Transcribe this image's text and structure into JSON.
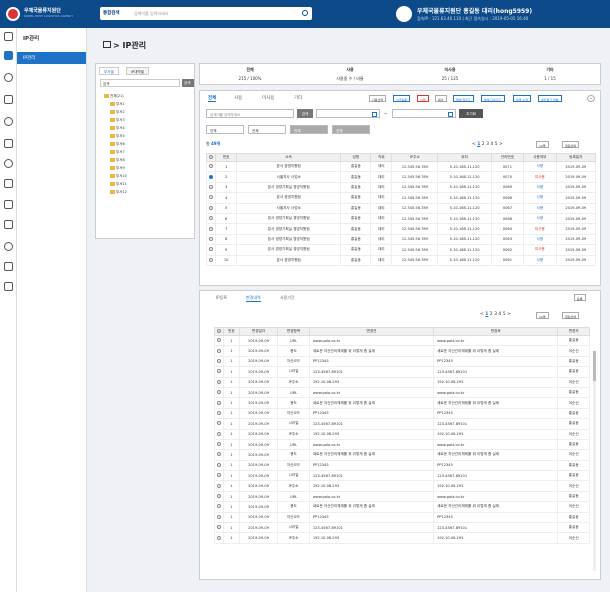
{
  "header": {
    "org_name": "우체국물류지원단",
    "org_sub": "KOREA POST LOGISTICS AGENCY",
    "search_scope": "통합검색",
    "search_placeholder": "검색어를 입력하세요",
    "user_name": "우체국물류지원단 홍길동 대리(hong5959)",
    "access_info": "접속IP : 121.63.40.110 | 최근 접속일시 : 2019-05-05 16:40"
  },
  "menu": {
    "title": "IP관리",
    "items": [
      {
        "label": "IP관리"
      }
    ]
  },
  "page": {
    "title": "IP관리"
  },
  "tree": {
    "tabs": [
      "부서별",
      "IP대역별"
    ],
    "search_label": "검색",
    "search_btn": "검색",
    "root": "전체(21)",
    "nodes": [
      "부서1",
      "부서2",
      "부서3",
      "부서4",
      "부서5",
      "부서6",
      "부서7",
      "부서8",
      "부서9",
      "부서10",
      "부서11",
      "부서12"
    ]
  },
  "stats": {
    "headers": [
      "전체",
      "사용",
      "미사용",
      "기타"
    ],
    "values": [
      "215 / 100%",
      "사용중 수 / 비율",
      "25 / 125",
      "1 / 15"
    ]
  },
  "list": {
    "tabs": [
      "전체",
      "사용",
      "미사용",
      "기타"
    ],
    "toolbar": [
      "사용선택",
      "선급등록",
      "삭제",
      "복사",
      "엑셀 업로드",
      "엑셀 다운로드",
      "일괄 수정",
      "네트워크 현황"
    ],
    "search_placeholder": "검색어를 입력하세요",
    "search_btn": "검색",
    "date_sep": "~",
    "reset_btn": "초기화",
    "filters": [
      "전체",
      "전체",
      "전체",
      "전체"
    ],
    "count_label": "총",
    "count_value": "49개",
    "pages": [
      "<",
      "1",
      "2",
      "3",
      "4",
      "5",
      ">"
    ],
    "page_size": "10줄",
    "pick_btn": "컬럼선택",
    "columns": [
      "번호",
      "소속",
      "성명",
      "직위",
      "IP주소",
      "위치",
      "관리번호",
      "사용여부",
      "등록일자"
    ],
    "rows": [
      {
        "no": "1",
        "org": "본사 경영지원팀",
        "name": "홍길동",
        "pos": "대리",
        "ip": "12.345.56.789",
        "loc": "5-10.168.11.120",
        "mgmt": "0071",
        "use": "사용",
        "date": "2019-09-09",
        "checked": false
      },
      {
        "no": "2",
        "org": "서울지사 사업소",
        "name": "홍길동",
        "pos": "대리",
        "ip": "12.345.56.789",
        "loc": "5-10.168.11.120",
        "mgmt": "0070",
        "use": "미사용",
        "date": "2019-09-09",
        "checked": true
      },
      {
        "no": "3",
        "org": "본사 경영기획실 경영지원팀",
        "name": "홍길동",
        "pos": "대리",
        "ip": "12.345.56.789",
        "loc": "5-10.168.11.120",
        "mgmt": "0069",
        "use": "사용",
        "date": "2019-09-09",
        "checked": false
      },
      {
        "no": "4",
        "org": "본사 경영지원팀",
        "name": "홍길동",
        "pos": "대리",
        "ip": "12.345.56.789",
        "loc": "5-10.168.11.120",
        "mgmt": "0068",
        "use": "사용",
        "date": "2019-09-09",
        "checked": false
      },
      {
        "no": "5",
        "org": "서울지사 사업소",
        "name": "홍길동",
        "pos": "대리",
        "ip": "12.345.56.789",
        "loc": "5-10.168.11.120",
        "mgmt": "0067",
        "use": "사용",
        "date": "2019-09-09",
        "checked": false
      },
      {
        "no": "6",
        "org": "본사 경영기획실 경영지원팀",
        "name": "홍길동",
        "pos": "대리",
        "ip": "12.345.56.789",
        "loc": "5-10.168.11.120",
        "mgmt": "0066",
        "use": "사용",
        "date": "2019-09-09",
        "checked": false
      },
      {
        "no": "7",
        "org": "본사 경영기획실 경영지원팀",
        "name": "홍길동",
        "pos": "대리",
        "ip": "12.345.56.789",
        "loc": "5-10.168.11.120",
        "mgmt": "0064",
        "use": "미사용",
        "date": "2019-09-09",
        "checked": false
      },
      {
        "no": "8",
        "org": "본사 경영기획실 경영지원팀",
        "name": "홍길동",
        "pos": "대리",
        "ip": "12.345.56.789",
        "loc": "5-10.168.11.120",
        "mgmt": "0063",
        "use": "사용",
        "date": "2019-09-09",
        "checked": false
      },
      {
        "no": "9",
        "org": "본사 경영기획실 경영지원팀",
        "name": "홍길동",
        "pos": "대리",
        "ip": "12.345.56.789",
        "loc": "5-10.168.11.120",
        "mgmt": "0062",
        "use": "미사용",
        "date": "2019-09-09",
        "checked": false
      },
      {
        "no": "10",
        "org": "본사 경영지원팀",
        "name": "홍길동",
        "pos": "대리",
        "ip": "12.345.56.789",
        "loc": "5-10.168.11.120",
        "mgmt": "0061",
        "use": "사용",
        "date": "2019-09-09",
        "checked": false
      }
    ]
  },
  "detail": {
    "tabs": [
      "IP등록",
      "변경내역",
      "사용기간"
    ],
    "save_btn": "등록",
    "pages": [
      "<",
      "1",
      "2",
      "3",
      "4",
      "5",
      ">"
    ],
    "page_size": "10줄",
    "pick_btn": "컬럼선택",
    "columns": [
      "번호",
      "변경일자",
      "변경항목",
      "변경전",
      "변경후",
      "변경자"
    ],
    "rows": [
      {
        "no": "1",
        "date": "2019-09-09",
        "item": "URL",
        "before": "www.pola.co.kr",
        "after": "www.pola.co.kr",
        "who": "홍길동"
      },
      {
        "no": "1",
        "date": "2019-09-09",
        "item": "용도",
        "before": "새로운 자산관리체제를 위 이렇게 좀 실제",
        "after": "새로운 자산관리체제를 위 이렇게 좀 실제",
        "who": "이순신"
      },
      {
        "no": "1",
        "date": "2019-09-09",
        "item": "자산코드",
        "before": "PP12345",
        "after": "PP12345",
        "who": "홍길동"
      },
      {
        "no": "1",
        "date": "2019-09-09",
        "item": "시리얼",
        "before": "123-4567-89101",
        "after": "123-4567-89101",
        "who": "홍길동"
      },
      {
        "no": "1",
        "date": "2019-09-09",
        "item": "IP주소",
        "before": "192.10.08.293",
        "after": "192.10.08.293",
        "who": "이순신"
      },
      {
        "no": "1",
        "date": "2019-09-09",
        "item": "URL",
        "before": "www.pola.co.kr",
        "after": "www.pola.co.kr",
        "who": "홍길동"
      },
      {
        "no": "1",
        "date": "2019-09-09",
        "item": "용도",
        "before": "새로운 자산관리체제를 위 이렇게 좀 실제",
        "after": "새로운 자산관리체제를 위 이렇게 좀 실제",
        "who": "이순신"
      },
      {
        "no": "1",
        "date": "2019-09-09",
        "item": "자산코드",
        "before": "PP12345",
        "after": "PP12345",
        "who": "홍길동"
      },
      {
        "no": "1",
        "date": "2019-09-09",
        "item": "시리얼",
        "before": "123-4567-89101",
        "after": "123-4567-89101",
        "who": "홍길동"
      },
      {
        "no": "1",
        "date": "2019-09-09",
        "item": "IP주소",
        "before": "192.10.08.293",
        "after": "192.10.08.293",
        "who": "이순신"
      },
      {
        "no": "1",
        "date": "2019-09-09",
        "item": "URL",
        "before": "www.pola.co.kr",
        "after": "www.pola.co.kr",
        "who": "홍길동"
      },
      {
        "no": "1",
        "date": "2019-09-09",
        "item": "용도",
        "before": "새로운 자산관리체제를 위 이렇게 좀 실제",
        "after": "새로운 자산관리체제를 위 이렇게 좀 실제",
        "who": "이순신"
      },
      {
        "no": "1",
        "date": "2019-09-09",
        "item": "자산코드",
        "before": "PP12345",
        "after": "PP12345",
        "who": "홍길동"
      },
      {
        "no": "1",
        "date": "2019-09-09",
        "item": "시리얼",
        "before": "123-4567-89101",
        "after": "123-4567-89101",
        "who": "홍길동"
      },
      {
        "no": "1",
        "date": "2019-09-09",
        "item": "IP주소",
        "before": "192.10.08.293",
        "after": "192.10.08.293",
        "who": "이순신"
      },
      {
        "no": "1",
        "date": "2019-09-09",
        "item": "URL",
        "before": "www.pola.co.kr",
        "after": "www.pola.co.kr",
        "who": "홍길동"
      },
      {
        "no": "1",
        "date": "2019-09-09",
        "item": "용도",
        "before": "새로운 자산관리체제를 위 이렇게 좀 실제",
        "after": "새로운 자산관리체제를 위 이렇게 좀 실제",
        "who": "이순신"
      },
      {
        "no": "1",
        "date": "2019-09-09",
        "item": "자산코드",
        "before": "PP12345",
        "after": "PP12345",
        "who": "홍길동"
      },
      {
        "no": "1",
        "date": "2019-09-09",
        "item": "시리얼",
        "before": "123-4567-89101",
        "after": "123-4567-89101",
        "who": "홍길동"
      },
      {
        "no": "1",
        "date": "2019-09-09",
        "item": "IP주소",
        "before": "192.10.08.293",
        "after": "192.10.08.293",
        "who": "이순신"
      }
    ]
  },
  "colors": {
    "header_bg": "#0c4a8a",
    "accent": "#1e73c8",
    "danger": "#dd3333"
  }
}
